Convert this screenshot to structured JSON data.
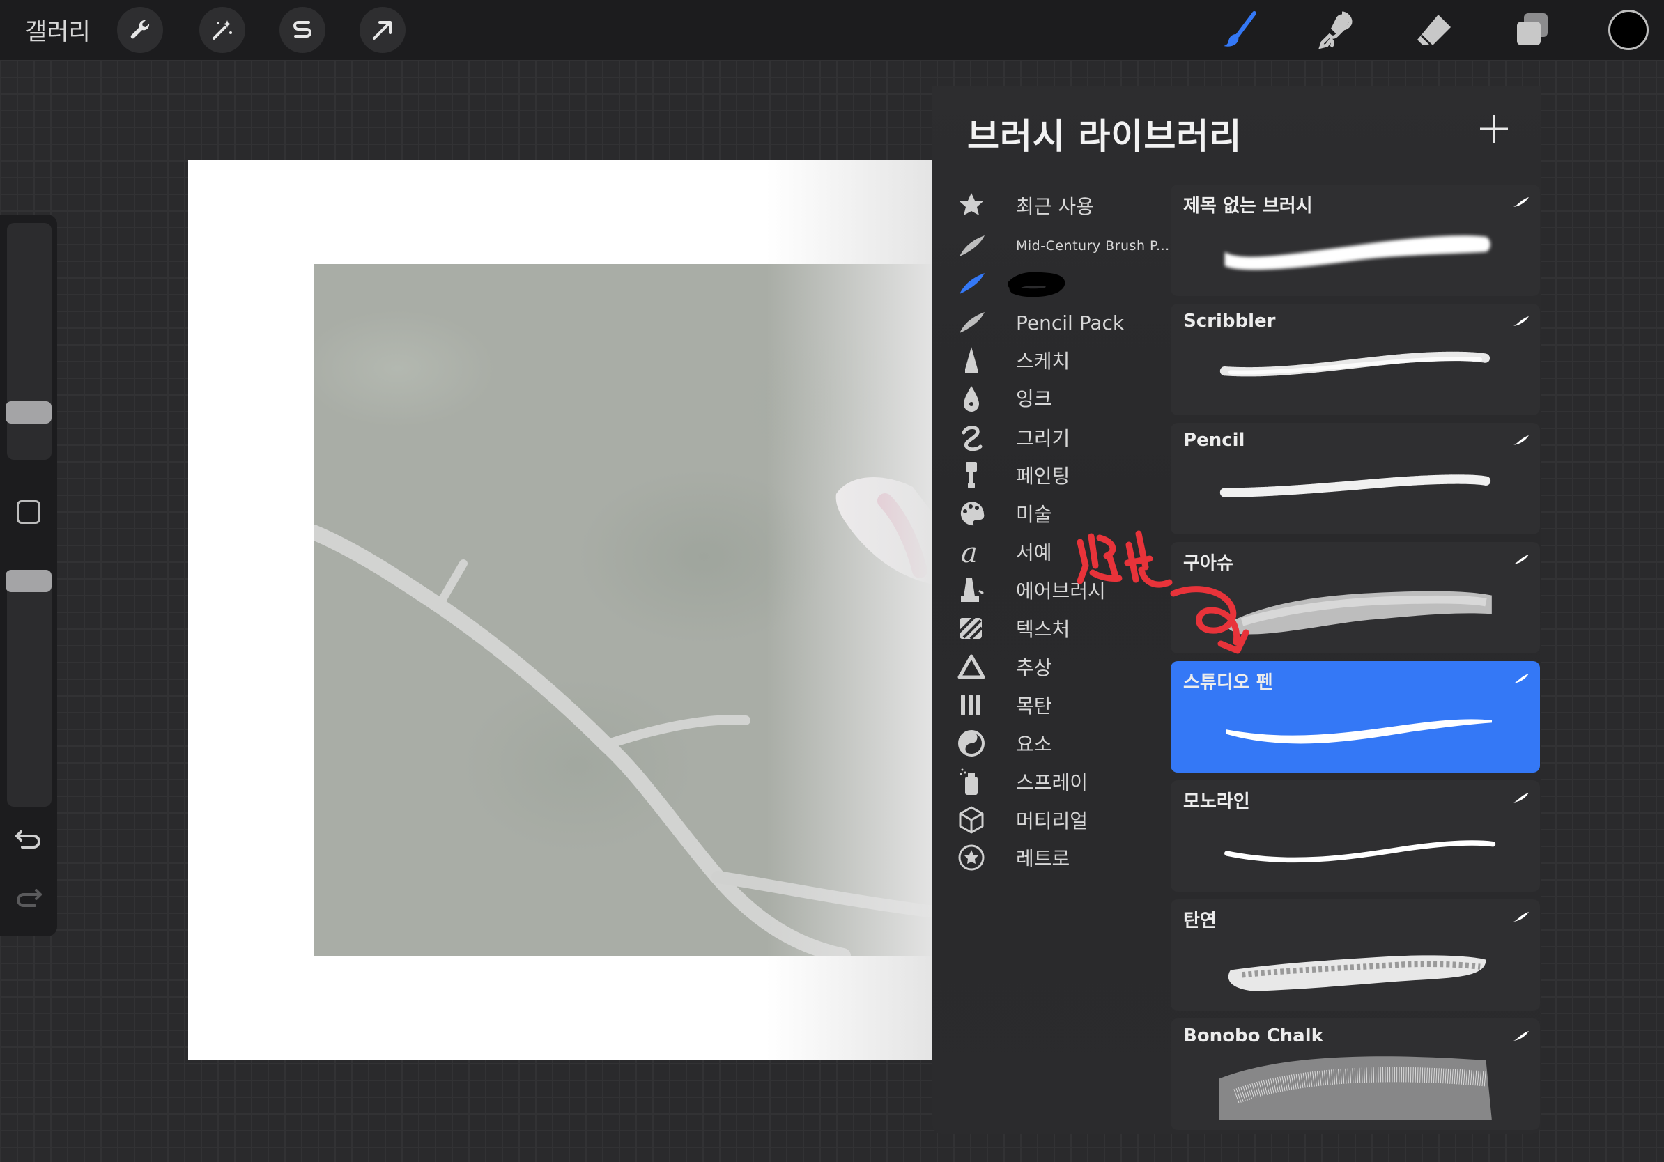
{
  "topbar": {
    "gallery_label": "갤러리",
    "left_tools": [
      "wrench-icon",
      "magic-wand-icon",
      "selection-s-icon",
      "move-arrow-icon"
    ],
    "right_tools": [
      "brush-icon",
      "smudge-icon",
      "eraser-icon",
      "layers-icon"
    ],
    "active_color": "#000000",
    "accent": "#3478f6"
  },
  "panel": {
    "title": "브러시 라이브러리",
    "categories": [
      {
        "label": "최근 사용",
        "icon": "star-icon"
      },
      {
        "label": "Mid-Century Brush P...",
        "icon": "brush-stroke-icon"
      },
      {
        "label": "",
        "icon": "brush-stroke-icon",
        "selected": true
      },
      {
        "label": "Pencil Pack",
        "icon": "brush-stroke-icon"
      },
      {
        "label": "스케치",
        "icon": "pencil-tip-icon"
      },
      {
        "label": "잉크",
        "icon": "ink-drop-icon"
      },
      {
        "label": "그리기",
        "icon": "squiggle-icon"
      },
      {
        "label": "페인팅",
        "icon": "paintbrush-icon"
      },
      {
        "label": "미술",
        "icon": "palette-icon"
      },
      {
        "label": "서예",
        "icon": "calligraphy-icon"
      },
      {
        "label": "에어브러시",
        "icon": "airbrush-icon"
      },
      {
        "label": "텍스처",
        "icon": "texture-icon"
      },
      {
        "label": "추상",
        "icon": "triangle-icon"
      },
      {
        "label": "목탄",
        "icon": "charcoal-icon"
      },
      {
        "label": "요소",
        "icon": "yin-yang-icon"
      },
      {
        "label": "스프레이",
        "icon": "spray-can-icon"
      },
      {
        "label": "머티리얼",
        "icon": "cube-icon"
      },
      {
        "label": "레트로",
        "icon": "retro-star-icon"
      }
    ],
    "brushes": [
      {
        "name": "제목 없는 브러시",
        "style": "soft-wide"
      },
      {
        "name": "Scribbler",
        "style": "grainy"
      },
      {
        "name": "Pencil",
        "style": "grainy-thin"
      },
      {
        "name": "구아슈",
        "style": "gouache"
      },
      {
        "name": "스튜디오 펜",
        "style": "pen",
        "selected": true
      },
      {
        "name": "모노라인",
        "style": "monoline"
      },
      {
        "name": "탄연",
        "style": "charcoal"
      },
      {
        "name": "Bonobo Chalk",
        "style": "chalk"
      }
    ]
  },
  "annotation": {
    "text": "선택",
    "color": "#e8333a"
  }
}
